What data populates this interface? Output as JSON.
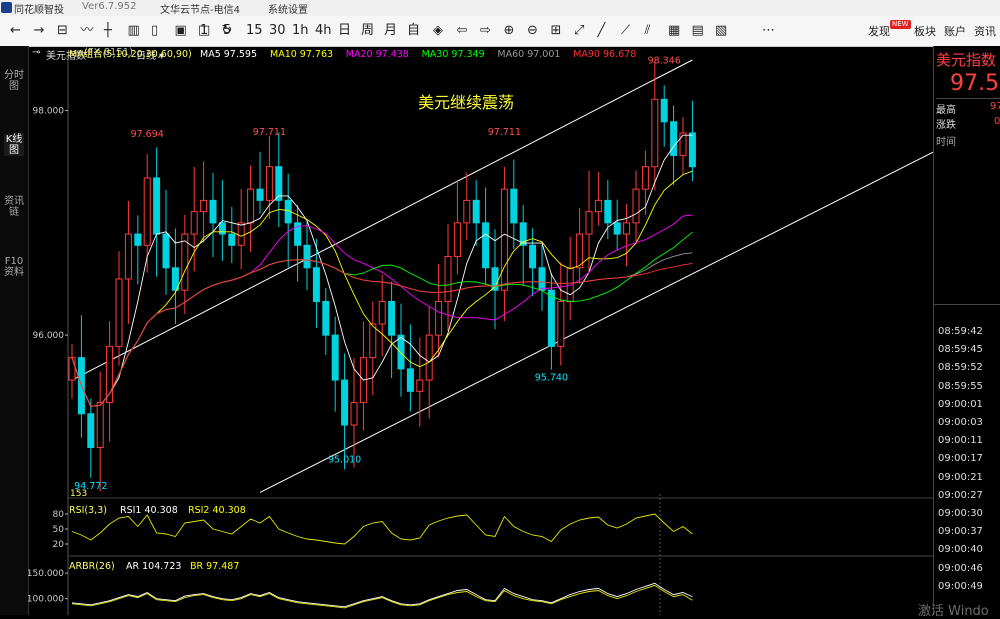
{
  "window": {
    "app_name": "同花顺智投",
    "version": "Ver6.7.952",
    "node": "文华云节点-电信4",
    "sys_menu": "系统设置"
  },
  "toolbar": {
    "icons": [
      "back-arrow-icon",
      "forward-arrow-icon",
      "split-view-icon",
      "line-chart-icon",
      "candlestick-icon",
      "bar-chart-icon",
      "file-icon",
      "save-icon",
      "window-icon",
      "refresh-icon"
    ],
    "periods": [
      "1",
      "5",
      "15",
      "30",
      "1h",
      "4h",
      "日",
      "周",
      "月",
      "自"
    ],
    "nav_icons": [
      "diamond-icon",
      "prev-icon",
      "next-icon",
      "zoom-in-icon",
      "zoom-out-icon",
      "bookmark-icon",
      "fullscreen-icon",
      "draw-line-icon",
      "draw-ray-icon",
      "draw-channel-icon",
      "grid-icon",
      "text-icon",
      "calc-icon"
    ],
    "more": "⋯",
    "right_links": [
      "发现",
      "板块",
      "账户",
      "资讯"
    ],
    "new_badge": "NEW"
  },
  "left_tabs": [
    "分时图",
    "K线图",
    "资讯链",
    "F10资料"
  ],
  "left_tab_active": 1,
  "instrument": {
    "name": "美元指数",
    "code": "FX 8151",
    "period": "日线"
  },
  "ma_legend": {
    "label": "MA组合(5,10,20,30,60,90)",
    "items": [
      {
        "text": "MA5 97.595",
        "color": "#ffffff"
      },
      {
        "text": "MA10 97.763",
        "color": "#ffff00"
      },
      {
        "text": "MA20 97.438",
        "color": "#ff00ff"
      },
      {
        "text": "MA30 97.349",
        "color": "#00ff00"
      },
      {
        "text": "MA60 97.001",
        "color": "#999999"
      },
      {
        "text": "MA90 96.678",
        "color": "#ff3030"
      }
    ]
  },
  "chart_annotation": "美元继续震荡",
  "chart_data": {
    "type": "candlestick",
    "y_ticks": [
      {
        "value": 98.0,
        "label": "98.000"
      },
      {
        "value": 96.0,
        "label": "96.000"
      }
    ],
    "ylim": [
      94.55,
      98.45
    ],
    "price_labels": [
      {
        "idx": 8,
        "value": 97.694,
        "label": "97.694",
        "pos": "above",
        "color": "#ff5050"
      },
      {
        "idx": 21,
        "value": 97.711,
        "label": "97.711",
        "pos": "above",
        "color": "#ff5050"
      },
      {
        "idx": 46,
        "value": 97.711,
        "label": "97.711",
        "pos": "above",
        "color": "#ff5050"
      },
      {
        "idx": 63,
        "value": 98.346,
        "label": "98.346",
        "pos": "above",
        "color": "#ff5050"
      },
      {
        "idx": 2,
        "value": 94.772,
        "label": "94.772",
        "pos": "below",
        "color": "#00e5ff"
      },
      {
        "idx": 29,
        "value": 95.01,
        "label": "95.010",
        "pos": "below",
        "color": "#00e5ff"
      },
      {
        "idx": 51,
        "value": 95.74,
        "label": "95.740",
        "pos": "below",
        "color": "#00e5ff"
      }
    ],
    "counter_label": "153",
    "trend_lines": [
      {
        "x1": 0,
        "y1": 95.6,
        "x2": 66,
        "y2": 98.45,
        "color": "#ffffff"
      },
      {
        "x1": 20,
        "y1": 94.6,
        "x2": 98,
        "y2": 97.9,
        "color": "#ffffff"
      }
    ],
    "closes": [
      95.8,
      95.3,
      95.0,
      95.4,
      95.9,
      96.5,
      96.9,
      96.8,
      97.4,
      96.9,
      96.6,
      96.4,
      96.9,
      97.1,
      97.2,
      97.0,
      96.9,
      96.8,
      97.0,
      97.3,
      97.2,
      97.5,
      97.2,
      97.0,
      96.8,
      96.6,
      96.3,
      96.0,
      95.6,
      95.2,
      95.4,
      95.8,
      96.1,
      96.3,
      96.0,
      95.7,
      95.5,
      95.6,
      96.0,
      96.3,
      96.7,
      97.0,
      97.2,
      97.0,
      96.6,
      96.4,
      97.3,
      97.0,
      96.8,
      96.6,
      96.4,
      95.9,
      96.3,
      96.6,
      96.9,
      97.1,
      97.2,
      97.0,
      96.9,
      97.0,
      97.3,
      97.5,
      98.1,
      97.9,
      97.6,
      97.8,
      97.5
    ],
    "rsi": {
      "label": "RSI(3,3)",
      "rsi1": "RSI1 40.308",
      "rsi2": "RSI2 40.308",
      "y_ticks": [
        "80",
        "50",
        "20"
      ],
      "values": [
        45,
        38,
        28,
        42,
        60,
        72,
        75,
        55,
        78,
        42,
        40,
        35,
        62,
        65,
        68,
        50,
        45,
        40,
        55,
        70,
        62,
        75,
        50,
        42,
        35,
        30,
        28,
        25,
        22,
        20,
        35,
        55,
        62,
        65,
        42,
        30,
        28,
        32,
        58,
        66,
        72,
        76,
        78,
        58,
        38,
        35,
        75,
        55,
        45,
        38,
        35,
        25,
        48,
        60,
        68,
        72,
        74,
        58,
        52,
        60,
        72,
        76,
        80,
        62,
        45,
        55,
        40
      ]
    },
    "arbr": {
      "label": "ARBR(26)",
      "ar": "AR 104.723",
      "br": "BR 97.487",
      "y_ticks": [
        "150.000",
        "100.000"
      ],
      "ar_values": [
        92,
        90,
        88,
        92,
        96,
        102,
        108,
        104,
        112,
        100,
        98,
        96,
        105,
        108,
        110,
        104,
        100,
        98,
        102,
        110,
        106,
        112,
        102,
        98,
        94,
        92,
        90,
        88,
        86,
        84,
        90,
        96,
        100,
        104,
        96,
        90,
        88,
        90,
        98,
        104,
        110,
        116,
        118,
        108,
        98,
        96,
        120,
        110,
        104,
        98,
        96,
        92,
        100,
        108,
        114,
        118,
        120,
        110,
        104,
        110,
        118,
        124,
        130,
        118,
        108,
        112,
        104
      ],
      "br_values": [
        90,
        88,
        86,
        90,
        94,
        100,
        106,
        102,
        110,
        98,
        96,
        94,
        102,
        106,
        108,
        102,
        98,
        96,
        100,
        108,
        104,
        110,
        100,
        96,
        92,
        90,
        88,
        86,
        84,
        82,
        88,
        94,
        98,
        102,
        94,
        88,
        86,
        88,
        96,
        102,
        108,
        112,
        114,
        104,
        96,
        94,
        116,
        106,
        100,
        96,
        94,
        90,
        98,
        104,
        110,
        114,
        116,
        106,
        100,
        106,
        114,
        120,
        126,
        114,
        104,
        108,
        97
      ]
    }
  },
  "right_panel": {
    "title": "美元指数",
    "price": "97.5",
    "high_label": "最高",
    "high_val": "97",
    "change_label": "涨跌",
    "change_val": "0",
    "time_header": "时间",
    "times": [
      "08:59:42",
      "08:59:45",
      "08:59:52",
      "08:59:55",
      "09:00:01",
      "09:00:03",
      "09:00:11",
      "09:00:17",
      "09:00:21",
      "09:00:27",
      "09:00:30",
      "09:00:37",
      "09:00:40",
      "09:00:46",
      "09:00:49"
    ]
  },
  "watermark": "激活 Windo"
}
